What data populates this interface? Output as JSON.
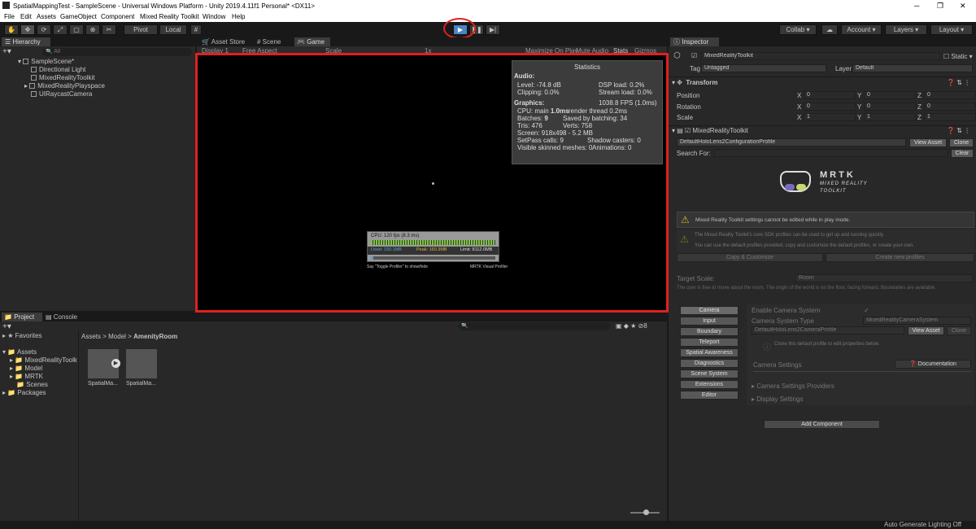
{
  "window": {
    "title": "SpatialMappingTest - SampleScene - Universal Windows Platform - Unity 2019.4.11f1 Personal* <DX11>"
  },
  "menu": [
    "File",
    "Edit",
    "Assets",
    "GameObject",
    "Component",
    "Mixed Reality Toolkit",
    "Window",
    "Help"
  ],
  "toolbar": {
    "pivot": "Pivot",
    "local": "Local",
    "collab": "Collab",
    "account": "Account",
    "layers": "Layers",
    "layout": "Layout"
  },
  "hierarchy": {
    "tab": "Hierarchy",
    "search_placeholder": "All",
    "scene": "SampleScene*",
    "items": [
      "Directional Light",
      "MixedRealityToolkit",
      "MixedRealityPlayspace",
      "UIRaycastCamera"
    ]
  },
  "game": {
    "tabs": [
      "Asset Store",
      "Scene",
      "Game"
    ],
    "display": "Display 1",
    "aspect": "Free Aspect",
    "scale_label": "Scale",
    "scale_value": "1x",
    "maximize": "Maximize On Play",
    "mute": "Mute Audio",
    "stats": "Stats",
    "gizmos": "Gizmos",
    "statistics": {
      "title": "Statistics",
      "audio_header": "Audio:",
      "level": "Level: -74.8 dB",
      "clipping": "Clipping: 0.0%",
      "dsp": "DSP load: 0.2%",
      "stream": "Stream load: 0.0%",
      "graphics_header": "Graphics:",
      "fps": "1038.8 FPS (1.0ms)",
      "cpu_prefix": "CPU: main ",
      "cpu_main": "1.0ms",
      "cpu_render": "render thread 0.2ms",
      "batches_prefix": "Batches: ",
      "batches": "9",
      "saved": "Saved by batching: 34",
      "tris": "Tris: 476",
      "verts": "Verts: 758",
      "screen": "Screen: 918x498 - 5.2 MB",
      "setpass": "SetPass calls: 9",
      "shadow": "Shadow casters: 0",
      "skinned": "Visible skinned meshes: 0",
      "animations": "Animations: 0"
    },
    "profiler": {
      "cpu": "CPU: 120 fps (8.3 ms)",
      "used": "Used: 150.1MB",
      "peak": "Peak: 160.3MB",
      "limit": "Limit: 8112.0MB",
      "toggle": "Say \"Toggle Profiler\" to show/hide",
      "mrtk": "MRTK Visual Profiler",
      "bar_fill": 0.02
    }
  },
  "project": {
    "tabs": [
      "Project",
      "Console"
    ],
    "favorites": "Favorites",
    "assets": "Assets",
    "folders": [
      "MixedRealityToolk",
      "Model",
      "MRTK",
      "Scenes"
    ],
    "packages": "Packages",
    "breadcrumb": [
      "Assets",
      "Model",
      "AmenityRoom"
    ],
    "files": [
      "SpatialMa...",
      "SpatialMa..."
    ],
    "count": "8"
  },
  "inspector": {
    "tab": "Inspector",
    "object": "MixedRealityToolkit",
    "static": "Static",
    "tag_label": "Tag",
    "tag": "Untagged",
    "layer_label": "Layer",
    "layer": "Default",
    "transform": "Transform",
    "rows": [
      {
        "label": "Position",
        "x": "0",
        "y": "0",
        "z": "0"
      },
      {
        "label": "Rotation",
        "x": "0",
        "y": "0",
        "z": "0"
      },
      {
        "label": "Scale",
        "x": "1",
        "y": "1",
        "z": "1"
      }
    ],
    "axis": [
      "X",
      "Y",
      "Z"
    ],
    "component": "MixedRealityToolkit",
    "profile": "DefaultHoloLens2ConfigurationProfile",
    "view_asset": "View Asset",
    "clone": "Clone",
    "search_for": "Search For:",
    "clear": "Clear",
    "logo_title": "MRTK",
    "logo_sub1": "MIXED REALITY",
    "logo_sub2": "TOOLKIT",
    "warning": "Mixed Reality Toolkit settings cannot be edited while in play mode.",
    "info1": "The Mixed Reality Toolkit's core SDK profiles can be used to get up and running quickly.",
    "info2": "You can use the default profiles provided, copy and customize the default profiles, or create your own.",
    "copy_customize": "Copy & Customize",
    "create_profile": "Create new profiles",
    "target_scale_label": "Target Scale:",
    "target_scale": "Room",
    "scale_desc": "The user is free to move about the room. The origin of the world is on the floor, facing forward. Boundaries are available.",
    "systems": [
      "Camera",
      "Input",
      "Boundary",
      "Teleport",
      "Spatial Awareness",
      "Diagnostics",
      "Scene System",
      "Extensions",
      "Editor"
    ],
    "enable_camera": "Enable Camera System",
    "camera_type_label": "Camera System Type",
    "camera_type": "MixedRealityCameraSystem",
    "camera_profile": "DefaultHoloLens2CameraProfile",
    "clone_note": "Clone this default profile to edit properties below.",
    "camera_settings": "Camera Settings",
    "documentation": "Documentation",
    "providers": "Camera Settings Providers",
    "display": "Display Settings",
    "add_component": "Add Component"
  },
  "status": {
    "lighting": "Auto Generate Lighting Off"
  },
  "colors": {
    "accent": "#4f8fd0",
    "highlight_red": "#e02020",
    "play_blue": "#4a84c4"
  }
}
